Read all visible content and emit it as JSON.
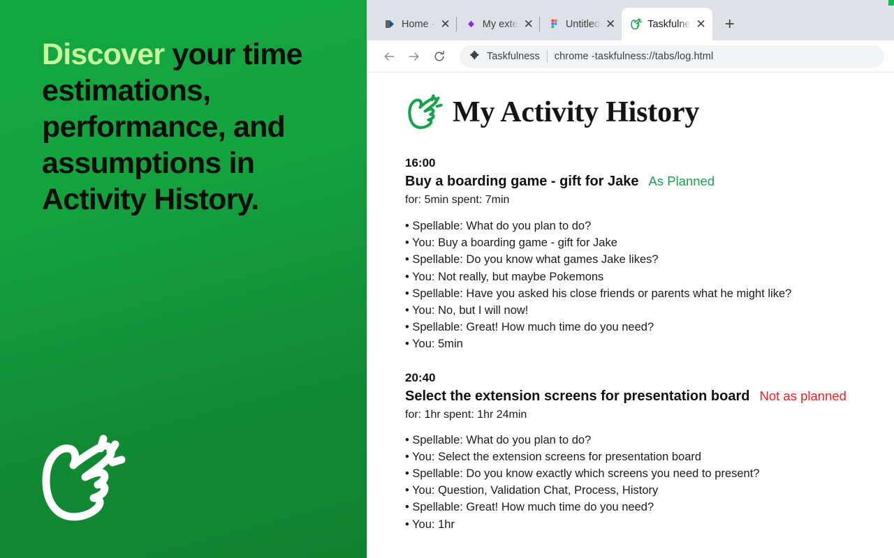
{
  "promo": {
    "headline_highlight": "Discover",
    "headline_rest": " your time estimations, performance, and assumptions in Activity History.",
    "logo_icon": "snap-hand-logo-icon",
    "gradient_from": "#13a840",
    "gradient_to": "#0f8230",
    "highlight_color": "#c6f79a",
    "text_color": "#0a0f0c"
  },
  "browser": {
    "tabs": [
      {
        "title": "Home -",
        "favicon": "home-bookmark-icon",
        "close_label": "✕",
        "active": false
      },
      {
        "title": "My exte",
        "favicon": "purple-diamond-icon",
        "close_label": "✕",
        "active": false
      },
      {
        "title": "Untitled",
        "favicon": "figma-icon",
        "close_label": "✕",
        "active": false
      },
      {
        "title": "Taskfulne",
        "favicon": "taskfulness-icon",
        "close_label": "✕",
        "active": true
      }
    ],
    "new_tab_label": "+",
    "toolbar": {
      "back_label": "←",
      "forward_label": "→",
      "reload_label": "⟳",
      "extension_icon": "puzzle-piece-icon",
      "extension_name": "Taskfulness",
      "url": "chrome -taskfulness://tabs/log.html"
    },
    "corner_accent_color": "#10b94b"
  },
  "page": {
    "logo_icon": "taskfulness-logo-icon",
    "title": "My Activity History",
    "status_colors": {
      "ok": "#1a9d4f",
      "bad": "#ee2222"
    },
    "entries": [
      {
        "time": "16:00",
        "title": "Buy a boarding game - gift for Jake",
        "status": "As Planned",
        "status_type": "ok",
        "meta": "for: 5min  spent: 7min",
        "dialog": [
          "• Spellable: What do you plan to do?",
          "• You: Buy a boarding game - gift for Jake",
          "• Spellable: Do you know what games Jake likes?",
          "• You: Not really, but maybe Pokemons",
          "• Spellable: Have you asked his close friends or parents what he might like?",
          "• You: No, but I will now!",
          "• Spellable: Great! How much time do you need?",
          "• You: 5min"
        ]
      },
      {
        "time": "20:40",
        "title": "Select the extension screens for presentation board",
        "status": "Not as planned",
        "status_type": "bad",
        "meta": "for: 1hr  spent: 1hr 24min",
        "dialog": [
          "• Spellable: What do you plan to do?",
          "• You: Select the extension screens for presentation board",
          "• Spellable: Do you know exactly which screens you need to present?",
          "• You: Question, Validation Chat, Process, History",
          "• Spellable: Great! How much time do you need?",
          "• You: 1hr"
        ]
      }
    ]
  }
}
